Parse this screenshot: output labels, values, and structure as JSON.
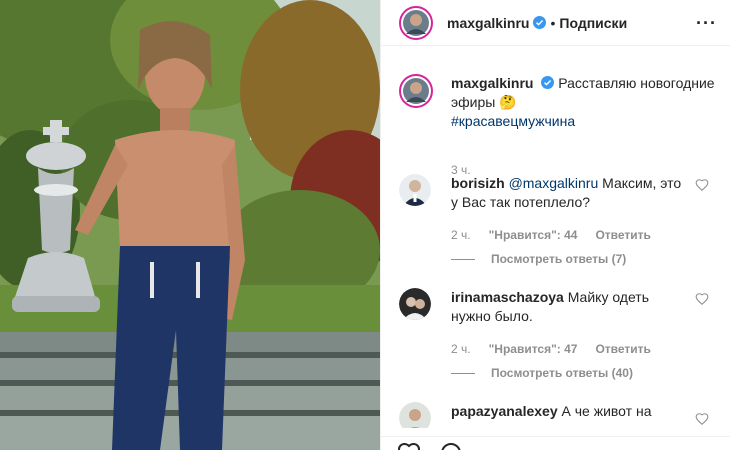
{
  "post": {
    "username": "maxgalkinru",
    "header_dot": "•",
    "follow_label": "Подписки",
    "more_label": "···",
    "caption_text": "Расставляю новогодние эфиры 🤔",
    "caption_hashtag": "#красавецмужчина",
    "caption_time": "3 ч."
  },
  "comments": [
    {
      "username": "borisizh",
      "mention": "@maxgalkinru",
      "text": " Максим, это у Вас так потеплело?",
      "time": "2 ч.",
      "likes": "\"Нравится\": 44",
      "reply": "Ответить",
      "view_replies": "Посмотреть ответы (7)"
    },
    {
      "username": "irinamaschazoya",
      "text": " Майку одеть нужно было.",
      "time": "2 ч.",
      "likes": "\"Нравится\": 47",
      "reply": "Ответить",
      "view_replies": "Посмотреть ответы (40)"
    },
    {
      "username": "papazyanalexey",
      "text": " А че живот на"
    }
  ],
  "colors": {
    "text": "#262626",
    "muted": "#8e8e8e",
    "link": "#00376b",
    "verified": "#3897f0",
    "border": "#efefef"
  },
  "icons": [
    "verified-badge-icon",
    "heart-icon",
    "comment-icon",
    "more-options-icon"
  ]
}
